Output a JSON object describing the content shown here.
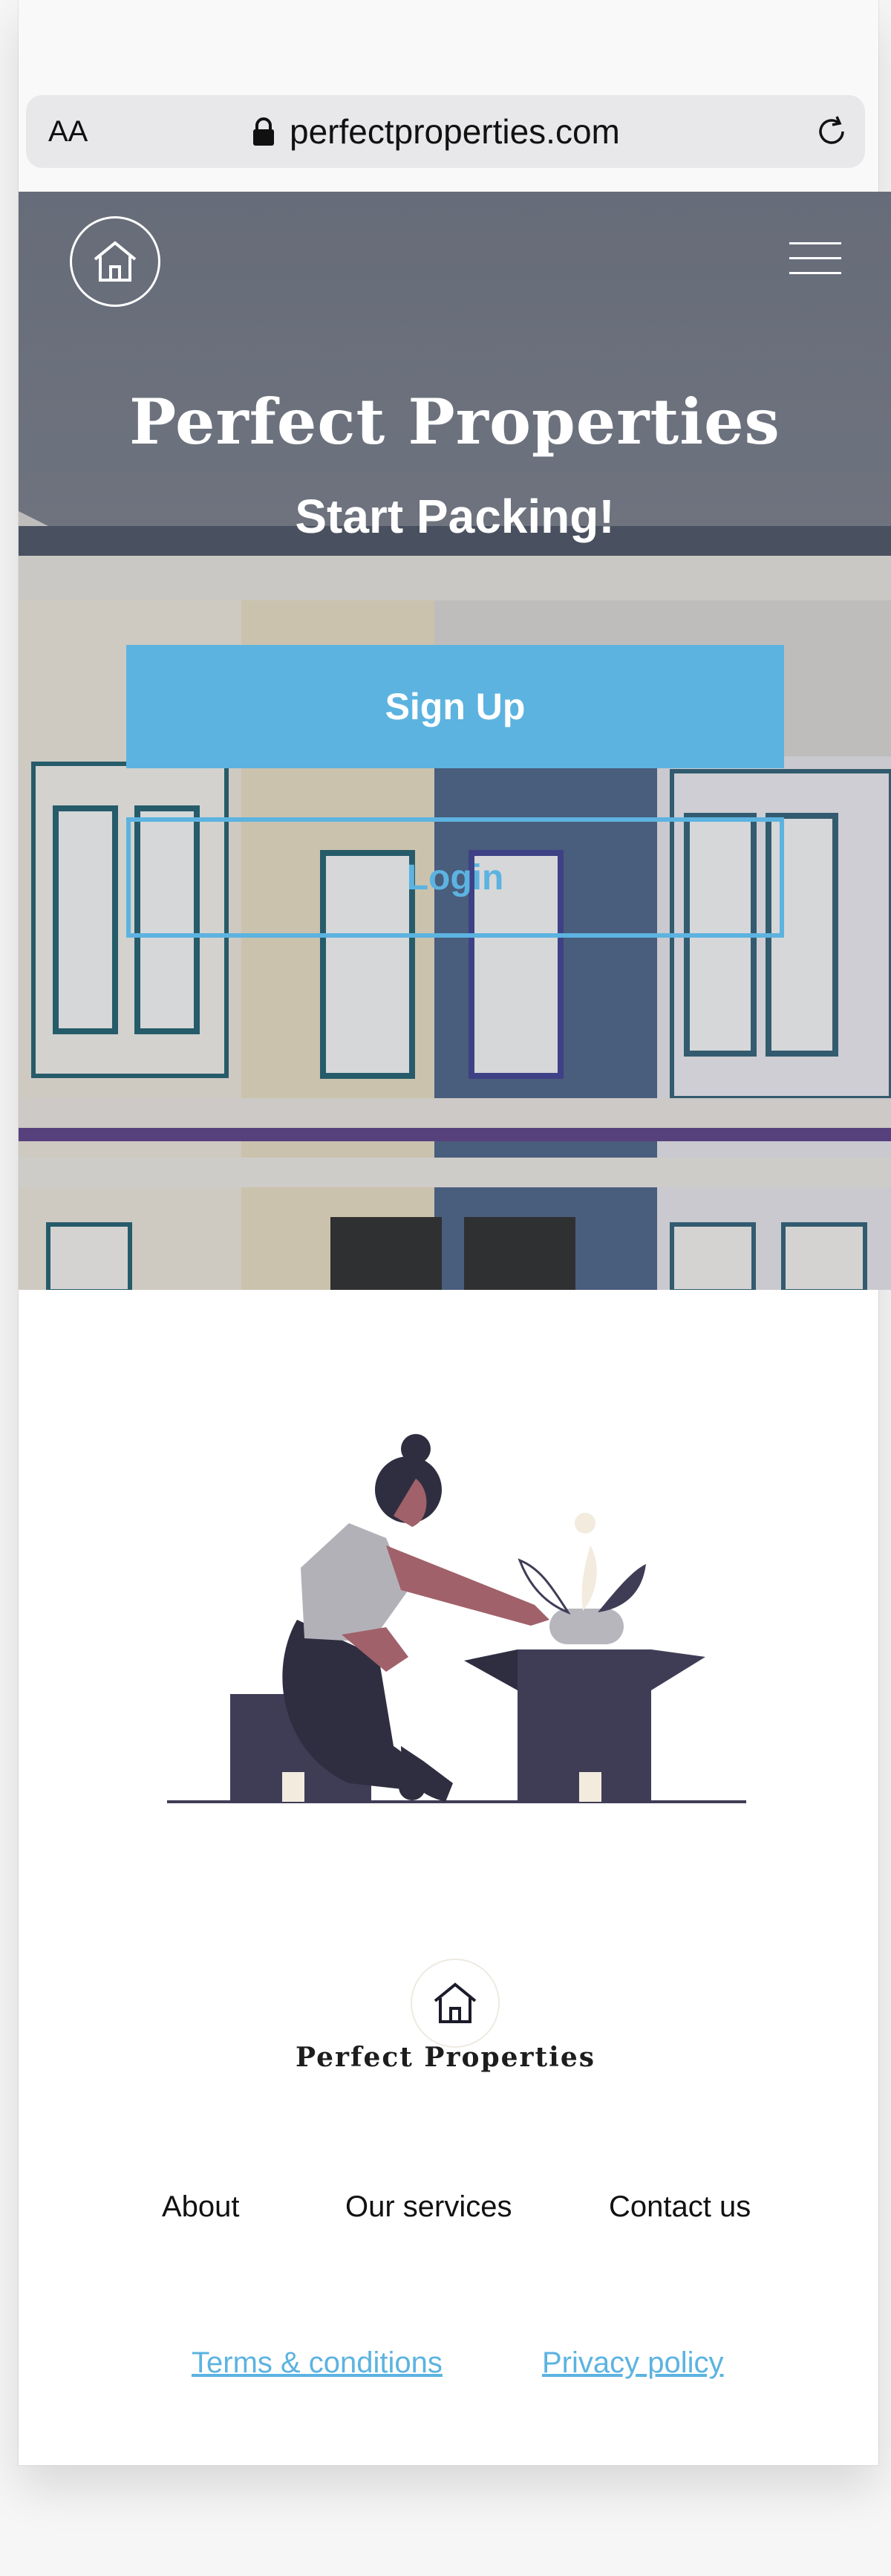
{
  "browser": {
    "text_size_label": "AA",
    "url": "perfectproperties.com"
  },
  "hero": {
    "title": "Perfect Properties",
    "subtitle": "Start Packing!",
    "signup_label": "Sign Up",
    "login_label": "Login"
  },
  "footer": {
    "brand": "Perfect  Properties",
    "nav": [
      "About",
      "Our services",
      "Contact us"
    ],
    "links": [
      "Terms & conditions",
      "Privacy policy"
    ]
  },
  "colors": {
    "accent": "#5cb3e0",
    "illustration_dark": "#3f3d56",
    "skin": "#a0616a"
  },
  "icons": [
    "text-size-icon",
    "lock-icon",
    "reload-icon",
    "home-icon",
    "menu-icon"
  ]
}
